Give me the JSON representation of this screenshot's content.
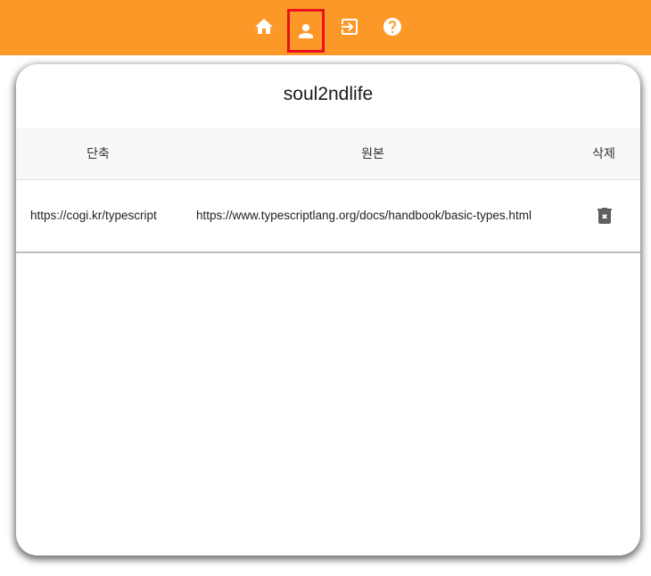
{
  "nav": {
    "items": [
      {
        "name": "home",
        "icon": "home-icon",
        "selected": false
      },
      {
        "name": "user",
        "icon": "person-icon",
        "selected": true
      },
      {
        "name": "login",
        "icon": "login-icon",
        "selected": false
      },
      {
        "name": "help",
        "icon": "help-circle-icon",
        "selected": false
      }
    ],
    "bar_color": "#fb9828",
    "selected_outline_color": "#e8121a"
  },
  "card": {
    "title": "soul2ndlife"
  },
  "table": {
    "headers": {
      "short": "단축",
      "original": "원본",
      "delete": "삭제"
    },
    "rows": [
      {
        "short": "https://cogi.kr/typescript",
        "original": "https://www.typescriptlang.org/docs/handbook/basic-types.html",
        "delete_icon": "trash-x-icon"
      }
    ]
  }
}
